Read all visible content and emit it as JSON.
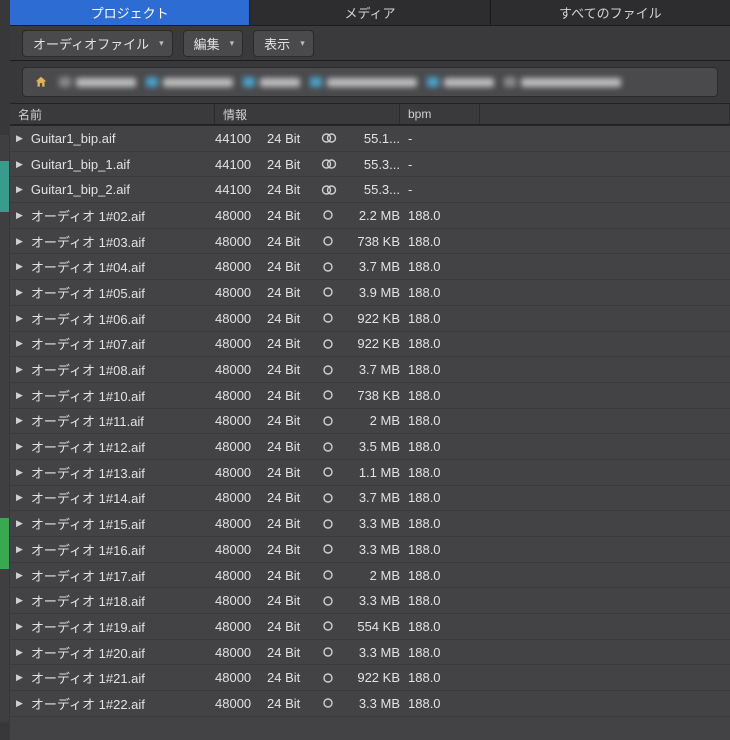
{
  "tabs": [
    {
      "label": "プロジェクト",
      "active": true
    },
    {
      "label": "メディア",
      "active": false
    },
    {
      "label": "すべてのファイル",
      "active": false
    }
  ],
  "toolbar": {
    "mode_label": "オーディオファイル",
    "edit_label": "編集",
    "view_label": "表示"
  },
  "columns": {
    "name": "名前",
    "info": "情報",
    "bpm": "bpm"
  },
  "files": [
    {
      "name": "Guitar1_bip.aif",
      "rate": "44100",
      "bits": "24 Bit",
      "ch": "stereo",
      "size": "55.1...",
      "bpm": "-"
    },
    {
      "name": "Guitar1_bip_1.aif",
      "rate": "44100",
      "bits": "24 Bit",
      "ch": "stereo",
      "size": "55.3...",
      "bpm": "-"
    },
    {
      "name": "Guitar1_bip_2.aif",
      "rate": "44100",
      "bits": "24 Bit",
      "ch": "stereo",
      "size": "55.3...",
      "bpm": "-"
    },
    {
      "name": "オーディオ 1#02.aif",
      "rate": "48000",
      "bits": "24 Bit",
      "ch": "mono",
      "size": "2.2 MB",
      "bpm": "188.0"
    },
    {
      "name": "オーディオ 1#03.aif",
      "rate": "48000",
      "bits": "24 Bit",
      "ch": "mono",
      "size": "738 KB",
      "bpm": "188.0"
    },
    {
      "name": "オーディオ 1#04.aif",
      "rate": "48000",
      "bits": "24 Bit",
      "ch": "mono",
      "size": "3.7 MB",
      "bpm": "188.0"
    },
    {
      "name": "オーディオ 1#05.aif",
      "rate": "48000",
      "bits": "24 Bit",
      "ch": "mono",
      "size": "3.9 MB",
      "bpm": "188.0"
    },
    {
      "name": "オーディオ 1#06.aif",
      "rate": "48000",
      "bits": "24 Bit",
      "ch": "mono",
      "size": "922 KB",
      "bpm": "188.0"
    },
    {
      "name": "オーディオ 1#07.aif",
      "rate": "48000",
      "bits": "24 Bit",
      "ch": "mono",
      "size": "922 KB",
      "bpm": "188.0"
    },
    {
      "name": "オーディオ 1#08.aif",
      "rate": "48000",
      "bits": "24 Bit",
      "ch": "mono",
      "size": "3.7 MB",
      "bpm": "188.0"
    },
    {
      "name": "オーディオ 1#10.aif",
      "rate": "48000",
      "bits": "24 Bit",
      "ch": "mono",
      "size": "738 KB",
      "bpm": "188.0"
    },
    {
      "name": "オーディオ 1#11.aif",
      "rate": "48000",
      "bits": "24 Bit",
      "ch": "mono",
      "size": "2 MB",
      "bpm": "188.0"
    },
    {
      "name": "オーディオ 1#12.aif",
      "rate": "48000",
      "bits": "24 Bit",
      "ch": "mono",
      "size": "3.5 MB",
      "bpm": "188.0"
    },
    {
      "name": "オーディオ 1#13.aif",
      "rate": "48000",
      "bits": "24 Bit",
      "ch": "mono",
      "size": "1.1 MB",
      "bpm": "188.0"
    },
    {
      "name": "オーディオ 1#14.aif",
      "rate": "48000",
      "bits": "24 Bit",
      "ch": "mono",
      "size": "3.7 MB",
      "bpm": "188.0"
    },
    {
      "name": "オーディオ 1#15.aif",
      "rate": "48000",
      "bits": "24 Bit",
      "ch": "mono",
      "size": "3.3 MB",
      "bpm": "188.0"
    },
    {
      "name": "オーディオ 1#16.aif",
      "rate": "48000",
      "bits": "24 Bit",
      "ch": "mono",
      "size": "3.3 MB",
      "bpm": "188.0"
    },
    {
      "name": "オーディオ 1#17.aif",
      "rate": "48000",
      "bits": "24 Bit",
      "ch": "mono",
      "size": "2 MB",
      "bpm": "188.0"
    },
    {
      "name": "オーディオ 1#18.aif",
      "rate": "48000",
      "bits": "24 Bit",
      "ch": "mono",
      "size": "3.3 MB",
      "bpm": "188.0"
    },
    {
      "name": "オーディオ 1#19.aif",
      "rate": "48000",
      "bits": "24 Bit",
      "ch": "mono",
      "size": "554 KB",
      "bpm": "188.0"
    },
    {
      "name": "オーディオ 1#20.aif",
      "rate": "48000",
      "bits": "24 Bit",
      "ch": "mono",
      "size": "3.3 MB",
      "bpm": "188.0"
    },
    {
      "name": "オーディオ 1#21.aif",
      "rate": "48000",
      "bits": "24 Bit",
      "ch": "mono",
      "size": "922 KB",
      "bpm": "188.0"
    },
    {
      "name": "オーディオ 1#22.aif",
      "rate": "48000",
      "bits": "24 Bit",
      "ch": "mono",
      "size": "3.3 MB",
      "bpm": "188.0"
    }
  ]
}
